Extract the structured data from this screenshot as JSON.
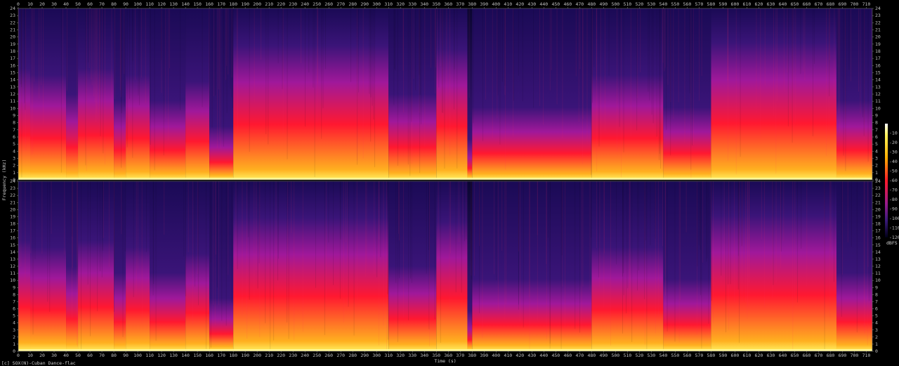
{
  "chart_data": {
    "type": "heatmap",
    "title": "",
    "xlabel": "Time (s)",
    "ylabel": "Frequency (kHz)",
    "xlim": [
      0,
      715
    ],
    "x_ticks": [
      0,
      10,
      20,
      30,
      40,
      50,
      60,
      70,
      80,
      90,
      100,
      110,
      120,
      130,
      140,
      150,
      160,
      170,
      180,
      190,
      200,
      210,
      220,
      230,
      240,
      250,
      260,
      270,
      280,
      290,
      300,
      310,
      320,
      330,
      340,
      350,
      360,
      370,
      380,
      390,
      400,
      410,
      420,
      430,
      440,
      450,
      460,
      470,
      480,
      490,
      500,
      510,
      520,
      530,
      540,
      550,
      560,
      570,
      580,
      590,
      600,
      610,
      620,
      630,
      640,
      650,
      660,
      670,
      680,
      690,
      700,
      710
    ],
    "ylim": [
      0,
      24
    ],
    "y_ticks": [
      0,
      1,
      2,
      3,
      4,
      5,
      6,
      7,
      8,
      9,
      10,
      11,
      12,
      13,
      14,
      15,
      16,
      17,
      18,
      19,
      20,
      21,
      22,
      23,
      24
    ],
    "channels": 2,
    "colorbar": {
      "label": "dBFS",
      "ticks": [
        -10,
        -20,
        -30,
        -40,
        -50,
        -60,
        -70,
        -80,
        -90,
        -100,
        -110,
        -120
      ],
      "range": [
        0,
        -120
      ]
    },
    "energy_segments": [
      {
        "t0": 0,
        "t1": 10,
        "level": 0.6
      },
      {
        "t0": 10,
        "t1": 40,
        "level": 0.55
      },
      {
        "t0": 40,
        "t1": 50,
        "level": 0.4
      },
      {
        "t0": 50,
        "t1": 80,
        "level": 0.6
      },
      {
        "t0": 80,
        "t1": 90,
        "level": 0.35
      },
      {
        "t0": 90,
        "t1": 110,
        "level": 0.55
      },
      {
        "t0": 110,
        "t1": 140,
        "level": 0.35
      },
      {
        "t0": 140,
        "t1": 160,
        "level": 0.5
      },
      {
        "t0": 160,
        "t1": 180,
        "level": 0.15
      },
      {
        "t0": 180,
        "t1": 310,
        "level": 0.78
      },
      {
        "t0": 310,
        "t1": 350,
        "level": 0.4
      },
      {
        "t0": 350,
        "t1": 376,
        "level": 0.75
      },
      {
        "t0": 376,
        "t1": 380,
        "level": 0.05
      },
      {
        "t0": 380,
        "t1": 480,
        "level": 0.3
      },
      {
        "t0": 480,
        "t1": 540,
        "level": 0.55
      },
      {
        "t0": 540,
        "t1": 580,
        "level": 0.3
      },
      {
        "t0": 580,
        "t1": 685,
        "level": 0.8
      },
      {
        "t0": 685,
        "t1": 715,
        "level": 0.35
      }
    ]
  },
  "footer": "[c] SOX(N)-Cuban Dance-flac"
}
